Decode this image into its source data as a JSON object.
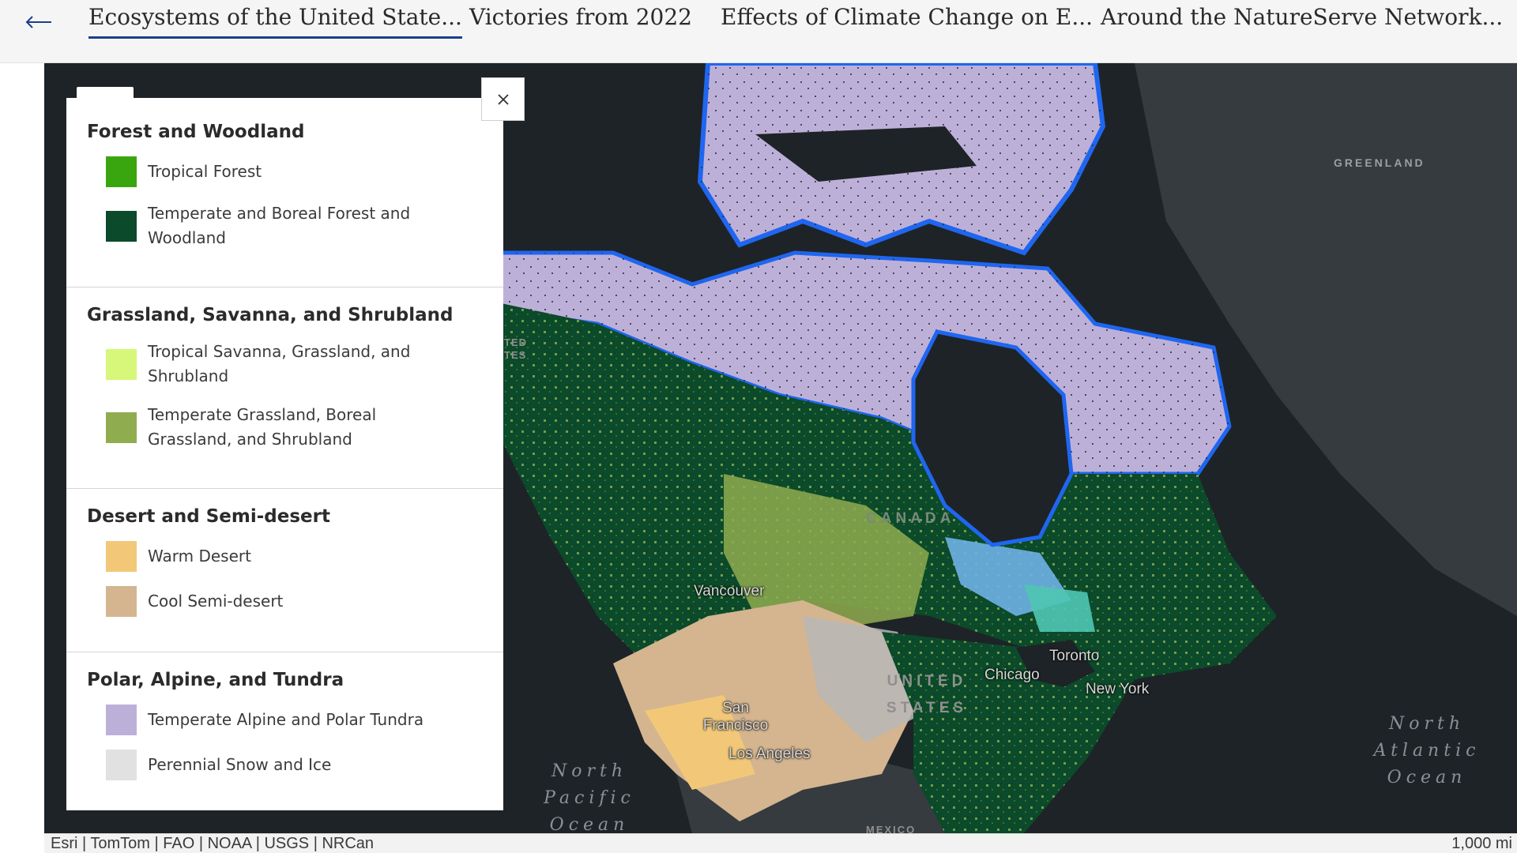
{
  "topbar": {
    "back_label": "←",
    "tabs": [
      {
        "label": "Ecosystems of the United State...",
        "active": true
      },
      {
        "label": "Victories from 2022",
        "active": false
      },
      {
        "label": "Effects of Climate Change on E...",
        "active": false
      },
      {
        "label": "Around the NatureServe Network...",
        "active": false
      }
    ]
  },
  "legend": {
    "sections": [
      {
        "heading": "Forest and Woodland",
        "items": [
          {
            "label": "Tropical Forest",
            "color": "#3aa60f"
          },
          {
            "label": "Temperate and Boreal Forest and Woodland",
            "color": "#0b4a2a"
          }
        ]
      },
      {
        "heading": "Grassland, Savanna, and Shrubland",
        "items": [
          {
            "label": "Tropical Savanna, Grassland, and Shrubland",
            "color": "#d6f77a"
          },
          {
            "label": "Temperate Grassland, Boreal Grassland, and Shrubland",
            "color": "#8fac4f"
          }
        ]
      },
      {
        "heading": "Desert and Semi-desert",
        "items": [
          {
            "label": "Warm Desert",
            "color": "#f2c878"
          },
          {
            "label": "Cool Semi-desert",
            "color": "#d4b590"
          }
        ]
      },
      {
        "heading": "Polar, Alpine, and Tundra",
        "items": [
          {
            "label": "Temperate Alpine and Polar Tundra",
            "color": "#bdb0d8"
          },
          {
            "label": "Perennial Snow and Ice",
            "color": "#e1e1e1"
          }
        ]
      }
    ]
  },
  "map": {
    "labels": {
      "greenland": "GREENLAND",
      "canada": "CANADA",
      "united_states": "UNITED STATES",
      "mexico": "MEXICO",
      "north_pacific": "North Pacific Ocean",
      "north_atlantic": "North Atlantic Ocean",
      "vancouver": "Vancouver",
      "toronto": "Toronto",
      "chicago": "Chicago",
      "new_york": "New York",
      "san_francisco": "San Francisco",
      "los_angeles": "Los Angeles",
      "edge_fragment": "TED TES"
    },
    "colors": {
      "ocean": "#1e2327",
      "land_dark": "#363b3f",
      "water_blue": "#1f66f0",
      "light_blue": "#6fb1e6",
      "teal": "#4fc7b3"
    }
  },
  "attribution": {
    "credits": "Esri | TomTom | FAO | NOAA | USGS | NRCan",
    "scale": "1,000 mi"
  }
}
